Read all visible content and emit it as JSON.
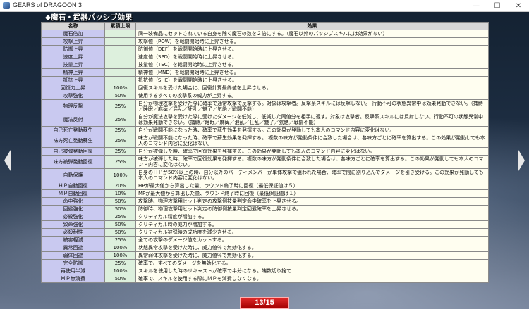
{
  "window": {
    "title": "GEARS of DRAGOON 3",
    "controls": {
      "minimize": "—",
      "maximize": "☐",
      "close": "✕"
    },
    "icon": "app-icon"
  },
  "section_title": "◆魔石・武器パッシブ効果",
  "table": {
    "headers": {
      "name": "名称",
      "limit": "累積上限",
      "effect": "効果"
    },
    "rows": [
      {
        "name": "魔石倍加",
        "limit": "",
        "effect": "同一装備品にセットされている自身を除く魔石の数を２倍にする。（魔石以外のパッシブスキルには効果がない）"
      },
      {
        "name": "攻撃上昇",
        "limit": "",
        "effect": "攻撃値（POW）を戦闘開始時に上昇させる。"
      },
      {
        "name": "防御上昇",
        "limit": "",
        "effect": "防御値（DEF）を戦闘開始時に上昇させる。"
      },
      {
        "name": "速度上昇",
        "limit": "",
        "effect": "速度値（SPD）を戦闘開始時に上昇させる。"
      },
      {
        "name": "技量上昇",
        "limit": "",
        "effect": "技量値（TEC）を戦闘開始時に上昇させる。"
      },
      {
        "name": "精神上昇",
        "limit": "",
        "effect": "精神値（MND）を戦闘開始時に上昇させる。"
      },
      {
        "name": "抵抗上昇",
        "limit": "",
        "effect": "抵抗値（SHE）を戦闘開始時に上昇させる。"
      },
      {
        "name": "回復力上昇",
        "limit": "100%",
        "effect": "回復スキルを受けた場合に、回復計算最終値を上昇させる。"
      },
      {
        "name": "攻撃強化",
        "limit": "50%",
        "effect": "使用するすべての攻撃系の威力が上昇する。"
      },
      {
        "name": "物理反撃",
        "limit": "25%",
        "effect": "自分が物理攻撃を受けた際に確率で通常攻撃で反撃する。対象は攻撃者。反撃系スキルには反撃しない。 行動不可の状態異常中は効果発動できない。（捕縛／睡眠／麻痺／混乱／狂乱／魅了／気絶／戦闘不能）"
      },
      {
        "name": "魔法反射",
        "limit": "25%",
        "effect": "自分が魔法攻撃を受けた際に受けたダメージを低減し、低減した同値分を相手に返す。対象は攻撃者。反撃系スキルには反射しない。行動不可の状態異常中は効果発動できない。（捕縛／睡眠／麻痺／混乱／狂乱／魅了／気絶／戦闘不能）"
      },
      {
        "name": "自己死亡発動蘇生",
        "limit": "25%",
        "effect": "自分が戦闘不能になった時、確率で蘇生効果を発揮する。この効果が発動しても本人のコマンド内容に変化はない。"
      },
      {
        "name": "味方死亡発動蘇生",
        "limit": "25%",
        "effect": "味方が戦闘不能になった時、確率で蘇生効果を発揮する。 複数の味方が発動条件に合致した場合は、各味方ごとに確率を算出する。この効果が発動しても本人のコマンド内容に変化はない。"
      },
      {
        "name": "自己被弾発動回復",
        "limit": "25%",
        "effect": "自分が被弾した時、確率で回復効果を発揮する。この効果が発動しても本人のコマンド内容に変化はない。"
      },
      {
        "name": "味方被弾発動回復",
        "limit": "25%",
        "effect": "味方が被弾した時、確率で回復効果を発揮する。複数の味方が発動条件に合致した場合は、各味方ごとに確率を算出する。この効果が発動しても本人のコマンド内容に変化はない。"
      },
      {
        "name": "自動保護",
        "limit": "100%",
        "effect": "自身のＨＰが50%以上の時、自分以外のパーティメンバーが単体攻撃で狙われた場合、確率で間に割り込んでダメージを引き受ける。この効果が発動しても本人のコマンド内容に変化はない。"
      },
      {
        "name": "ＨＰ自動回復",
        "limit": "20%",
        "effect": "HPが最大値から算出した量、ラウンド終了時に回復（最低保証値は５）"
      },
      {
        "name": "ＭＰ自動回復",
        "limit": "10%",
        "effect": "MPが最大値から算出した量、ラウンド終了時に回復（最低保証値は１）"
      },
      {
        "name": "命中強化",
        "limit": "50%",
        "effect": "攻撃時、物理攻撃用ヒット判定の攻撃側技量判定命中確率を上昇させる。"
      },
      {
        "name": "回避強化",
        "limit": "50%",
        "effect": "防御時、物理攻撃用ヒット判定の防御側技量判定回避確率を上昇させる。"
      },
      {
        "name": "必殺強化",
        "limit": "25%",
        "effect": "クリティカル精度が増加する。"
      },
      {
        "name": "致命強化",
        "limit": "50%",
        "effect": "クリティカル時の威力が増加する。"
      },
      {
        "name": "必殺耐性",
        "limit": "50%",
        "effect": "クリティカル被弾時の成功度を減少させる。"
      },
      {
        "name": "被害軽減",
        "limit": "25%",
        "effect": "全ての攻撃のダメージ値をカットする。"
      },
      {
        "name": "異常回避",
        "limit": "100%",
        "effect": "状態異常攻撃を受けた時に、威力値％で無効化する。"
      },
      {
        "name": "弱体回避",
        "limit": "100%",
        "effect": "異常弱体攻撃を受けた時に、威力値％で無効化する。"
      },
      {
        "name": "完全防御",
        "limit": "25%",
        "effect": "確率で、すべてのダメージを無効化する。"
      },
      {
        "name": "再使用半減",
        "limit": "100%",
        "effect": "スキルを使用した時のリキャストが確率で半分になる。端数切り捨て"
      },
      {
        "name": "ＭＰ無消費",
        "limit": "50%",
        "effect": "確率で、スキルを使用する際にＭＰを消費しなくなる。"
      }
    ]
  },
  "navigation": {
    "prev_icon": "arrow-left-icon",
    "next_icon": "arrow-right-icon"
  },
  "pager": {
    "label": "13/15",
    "current": 13,
    "total": 15
  }
}
